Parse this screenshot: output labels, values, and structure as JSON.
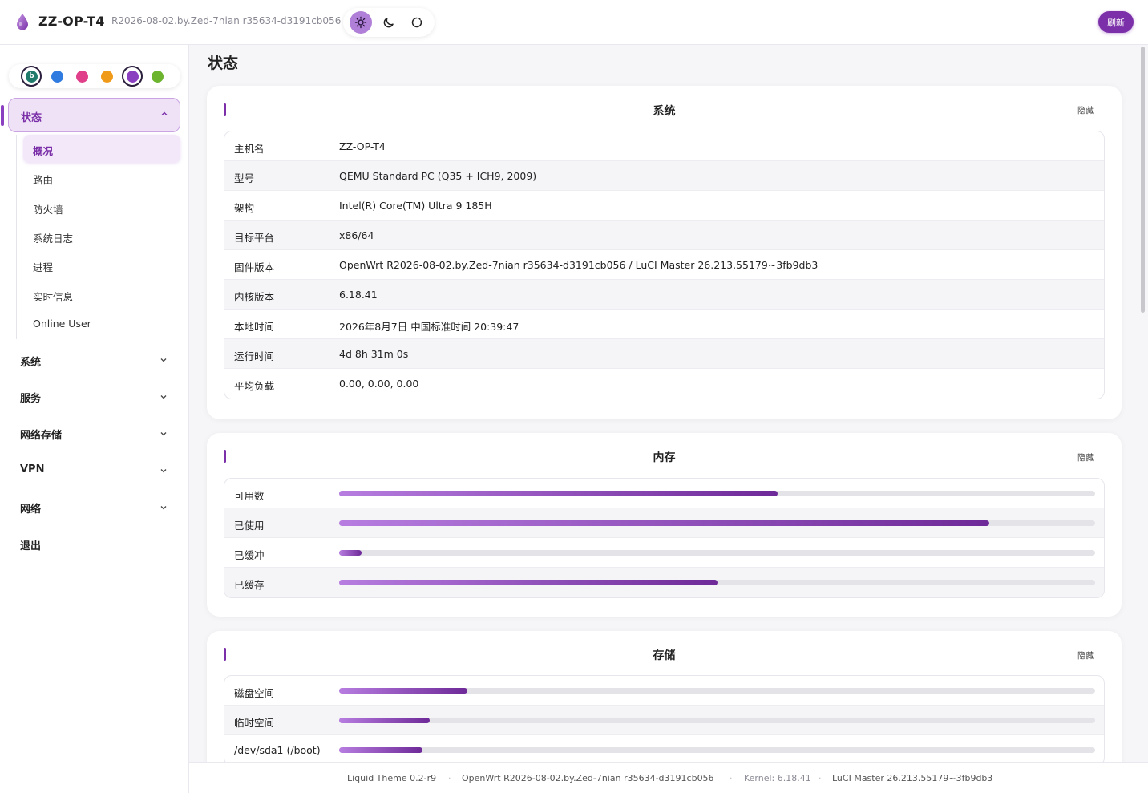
{
  "header": {
    "brand": "ZZ-OP-T4",
    "version": "R2026-08-02.by.Zed-7nian r35634-d3191cb056",
    "refresh_label": "刷新",
    "modes": [
      "sun-icon",
      "moon-icon",
      "auto-icon"
    ]
  },
  "sidebar": {
    "swatch_letter": "b",
    "swatches": [
      "#1f7a6b",
      "#2f7be0",
      "#e03f8a",
      "#f09a1a",
      "#8a3fc0",
      "#6cb32e"
    ],
    "active_group": "状态",
    "status_items": [
      "概况",
      "路由",
      "防火墙",
      "系统日志",
      "进程",
      "实时信息",
      "Online User"
    ],
    "groups": [
      "系统",
      "服务",
      "网络存储",
      "VPN",
      "网络",
      "退出"
    ]
  },
  "page": {
    "title": "状态"
  },
  "system_card": {
    "title": "系统",
    "hide_label": "隐藏",
    "rows": [
      {
        "k": "主机名",
        "v": "ZZ-OP-T4"
      },
      {
        "k": "型号",
        "v": "QEMU Standard PC (Q35 + ICH9, 2009)"
      },
      {
        "k": "架构",
        "v": "Intel(R) Core(TM) Ultra 9 185H"
      },
      {
        "k": "目标平台",
        "v": "x86/64"
      },
      {
        "k": "固件版本",
        "v": "OpenWrt R2026-08-02.by.Zed-7nian r35634-d3191cb056 / LuCI Master 26.213.55179~3fb9db3"
      },
      {
        "k": "内核版本",
        "v": "6.18.41"
      },
      {
        "k": "本地时间",
        "v": "2026年8月7日 中国标准时间 20:39:47"
      },
      {
        "k": "运行时间",
        "v": "4d 8h 31m 0s"
      },
      {
        "k": "平均负载",
        "v": "0.00, 0.00, 0.00"
      }
    ]
  },
  "memory_card": {
    "title": "内存",
    "hide_label": "隐藏",
    "rows": [
      {
        "k": "可用数",
        "fraction": 0.58
      },
      {
        "k": "已使用",
        "fraction": 0.86
      },
      {
        "k": "已缓冲",
        "fraction": 0.03
      },
      {
        "k": "已缓存",
        "fraction": 0.5
      }
    ]
  },
  "storage_card": {
    "title": "存储",
    "hide_label": "隐藏",
    "rows": [
      {
        "k": "磁盘空间",
        "fraction": 0.17
      },
      {
        "k": "临时空间",
        "fraction": 0.12
      },
      {
        "k": "/dev/sda1 (/boot)",
        "fraction": 0.11
      }
    ]
  },
  "footer": {
    "theme": "Liquid Theme 0.2-r9",
    "openwrt": "OpenWrt R2026-08-02.by.Zed-7nian r35634-d3191cb056",
    "kernel": "Kernel: 6.18.41",
    "luci": "LuCI Master 26.213.55179~3fb9db3"
  }
}
